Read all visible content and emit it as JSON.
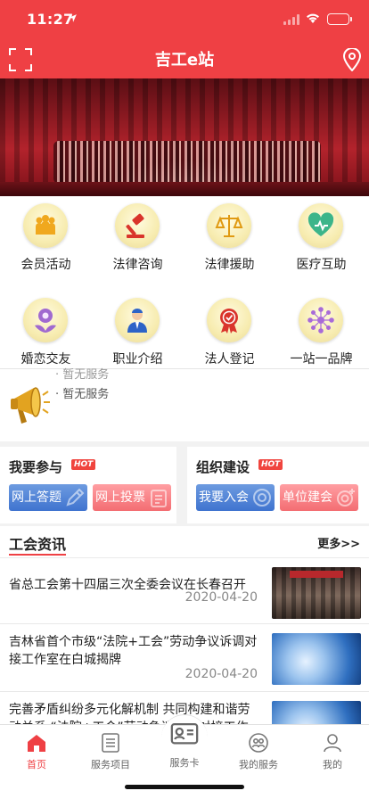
{
  "status_bar": {
    "time": "11:27"
  },
  "nav": {
    "title": "吉工e站"
  },
  "services": [
    {
      "label": "会员活动",
      "icon": "member-activity-icon"
    },
    {
      "label": "法律咨询",
      "icon": "gavel-icon"
    },
    {
      "label": "法律援助",
      "icon": "scales-icon"
    },
    {
      "label": "医疗互助",
      "icon": "heart-care-icon"
    },
    {
      "label": "婚恋交友",
      "icon": "flower-icon"
    },
    {
      "label": "职业介绍",
      "icon": "worker-icon"
    },
    {
      "label": "法人登记",
      "icon": "seal-badge-icon"
    },
    {
      "label": "一站一品牌",
      "icon": "network-icon"
    }
  ],
  "notice": {
    "previous": "· 暂无服务",
    "current": "· 暂无服务"
  },
  "participate": {
    "title": "我要参与",
    "hot": "HOT",
    "buttons": [
      "网上答题",
      "网上投票"
    ]
  },
  "organization": {
    "title": "组织建设",
    "hot": "HOT",
    "buttons": [
      "我要入会",
      "单位建会"
    ]
  },
  "news": {
    "title": "工会资讯",
    "more": "更多>>",
    "items": [
      {
        "title": "省总工会第十四届三次全委会议在长春召开",
        "date": "2020-04-20",
        "thumb": "meeting-photo"
      },
      {
        "title": "吉林省首个市级“法院+工会”劳动争议诉调对接工作室在白城揭牌",
        "date": "2020-04-20",
        "thumb": "globe-photo"
      },
      {
        "title": "完善矛盾纠纷多元化解机制 共同构建和谐劳动关系 “法院+工会”劳动争议诉调对接工作",
        "date": "",
        "thumb": "globe-photo"
      }
    ]
  },
  "tabbar": {
    "items": [
      {
        "label": "首页",
        "icon": "home-icon",
        "active": true
      },
      {
        "label": "服务项目",
        "icon": "list-icon",
        "active": false
      },
      {
        "label": "服务卡",
        "icon": "card-icon",
        "active": false
      },
      {
        "label": "我的服务",
        "icon": "people-icon",
        "active": false
      },
      {
        "label": "我的",
        "icon": "user-icon",
        "active": false
      }
    ]
  },
  "colors": {
    "brand": "#ef4044",
    "blue_button": "#4f82d6",
    "pink_button": "#f57c80"
  }
}
